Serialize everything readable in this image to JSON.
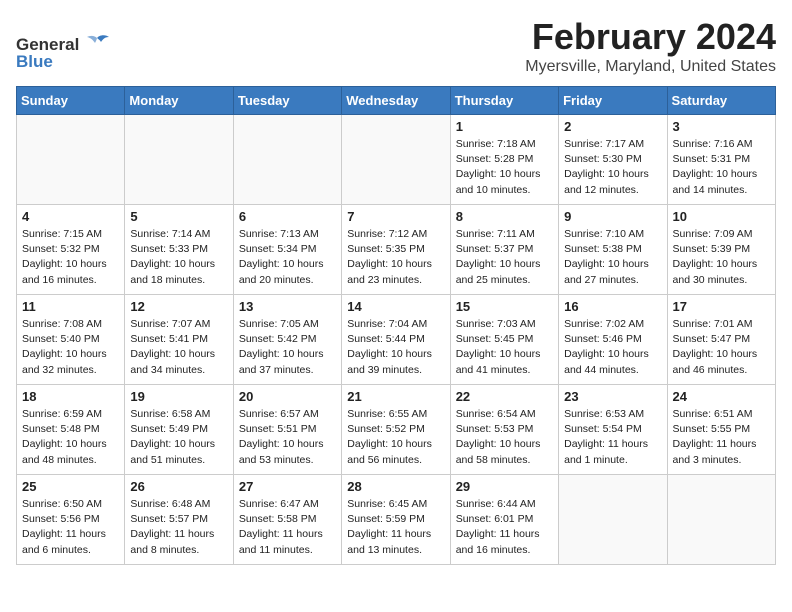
{
  "header": {
    "month_year": "February 2024",
    "location": "Myersville, Maryland, United States"
  },
  "logo": {
    "line1": "General",
    "line2": "Blue",
    "icon": "🐦"
  },
  "days_of_week": [
    "Sunday",
    "Monday",
    "Tuesday",
    "Wednesday",
    "Thursday",
    "Friday",
    "Saturday"
  ],
  "weeks": [
    [
      {
        "day": "",
        "content": ""
      },
      {
        "day": "",
        "content": ""
      },
      {
        "day": "",
        "content": ""
      },
      {
        "day": "",
        "content": ""
      },
      {
        "day": "1",
        "content": "Sunrise: 7:18 AM\nSunset: 5:28 PM\nDaylight: 10 hours\nand 10 minutes."
      },
      {
        "day": "2",
        "content": "Sunrise: 7:17 AM\nSunset: 5:30 PM\nDaylight: 10 hours\nand 12 minutes."
      },
      {
        "day": "3",
        "content": "Sunrise: 7:16 AM\nSunset: 5:31 PM\nDaylight: 10 hours\nand 14 minutes."
      }
    ],
    [
      {
        "day": "4",
        "content": "Sunrise: 7:15 AM\nSunset: 5:32 PM\nDaylight: 10 hours\nand 16 minutes."
      },
      {
        "day": "5",
        "content": "Sunrise: 7:14 AM\nSunset: 5:33 PM\nDaylight: 10 hours\nand 18 minutes."
      },
      {
        "day": "6",
        "content": "Sunrise: 7:13 AM\nSunset: 5:34 PM\nDaylight: 10 hours\nand 20 minutes."
      },
      {
        "day": "7",
        "content": "Sunrise: 7:12 AM\nSunset: 5:35 PM\nDaylight: 10 hours\nand 23 minutes."
      },
      {
        "day": "8",
        "content": "Sunrise: 7:11 AM\nSunset: 5:37 PM\nDaylight: 10 hours\nand 25 minutes."
      },
      {
        "day": "9",
        "content": "Sunrise: 7:10 AM\nSunset: 5:38 PM\nDaylight: 10 hours\nand 27 minutes."
      },
      {
        "day": "10",
        "content": "Sunrise: 7:09 AM\nSunset: 5:39 PM\nDaylight: 10 hours\nand 30 minutes."
      }
    ],
    [
      {
        "day": "11",
        "content": "Sunrise: 7:08 AM\nSunset: 5:40 PM\nDaylight: 10 hours\nand 32 minutes."
      },
      {
        "day": "12",
        "content": "Sunrise: 7:07 AM\nSunset: 5:41 PM\nDaylight: 10 hours\nand 34 minutes."
      },
      {
        "day": "13",
        "content": "Sunrise: 7:05 AM\nSunset: 5:42 PM\nDaylight: 10 hours\nand 37 minutes."
      },
      {
        "day": "14",
        "content": "Sunrise: 7:04 AM\nSunset: 5:44 PM\nDaylight: 10 hours\nand 39 minutes."
      },
      {
        "day": "15",
        "content": "Sunrise: 7:03 AM\nSunset: 5:45 PM\nDaylight: 10 hours\nand 41 minutes."
      },
      {
        "day": "16",
        "content": "Sunrise: 7:02 AM\nSunset: 5:46 PM\nDaylight: 10 hours\nand 44 minutes."
      },
      {
        "day": "17",
        "content": "Sunrise: 7:01 AM\nSunset: 5:47 PM\nDaylight: 10 hours\nand 46 minutes."
      }
    ],
    [
      {
        "day": "18",
        "content": "Sunrise: 6:59 AM\nSunset: 5:48 PM\nDaylight: 10 hours\nand 48 minutes."
      },
      {
        "day": "19",
        "content": "Sunrise: 6:58 AM\nSunset: 5:49 PM\nDaylight: 10 hours\nand 51 minutes."
      },
      {
        "day": "20",
        "content": "Sunrise: 6:57 AM\nSunset: 5:51 PM\nDaylight: 10 hours\nand 53 minutes."
      },
      {
        "day": "21",
        "content": "Sunrise: 6:55 AM\nSunset: 5:52 PM\nDaylight: 10 hours\nand 56 minutes."
      },
      {
        "day": "22",
        "content": "Sunrise: 6:54 AM\nSunset: 5:53 PM\nDaylight: 10 hours\nand 58 minutes."
      },
      {
        "day": "23",
        "content": "Sunrise: 6:53 AM\nSunset: 5:54 PM\nDaylight: 11 hours\nand 1 minute."
      },
      {
        "day": "24",
        "content": "Sunrise: 6:51 AM\nSunset: 5:55 PM\nDaylight: 11 hours\nand 3 minutes."
      }
    ],
    [
      {
        "day": "25",
        "content": "Sunrise: 6:50 AM\nSunset: 5:56 PM\nDaylight: 11 hours\nand 6 minutes."
      },
      {
        "day": "26",
        "content": "Sunrise: 6:48 AM\nSunset: 5:57 PM\nDaylight: 11 hours\nand 8 minutes."
      },
      {
        "day": "27",
        "content": "Sunrise: 6:47 AM\nSunset: 5:58 PM\nDaylight: 11 hours\nand 11 minutes."
      },
      {
        "day": "28",
        "content": "Sunrise: 6:45 AM\nSunset: 5:59 PM\nDaylight: 11 hours\nand 13 minutes."
      },
      {
        "day": "29",
        "content": "Sunrise: 6:44 AM\nSunset: 6:01 PM\nDaylight: 11 hours\nand 16 minutes."
      },
      {
        "day": "",
        "content": ""
      },
      {
        "day": "",
        "content": ""
      }
    ]
  ]
}
